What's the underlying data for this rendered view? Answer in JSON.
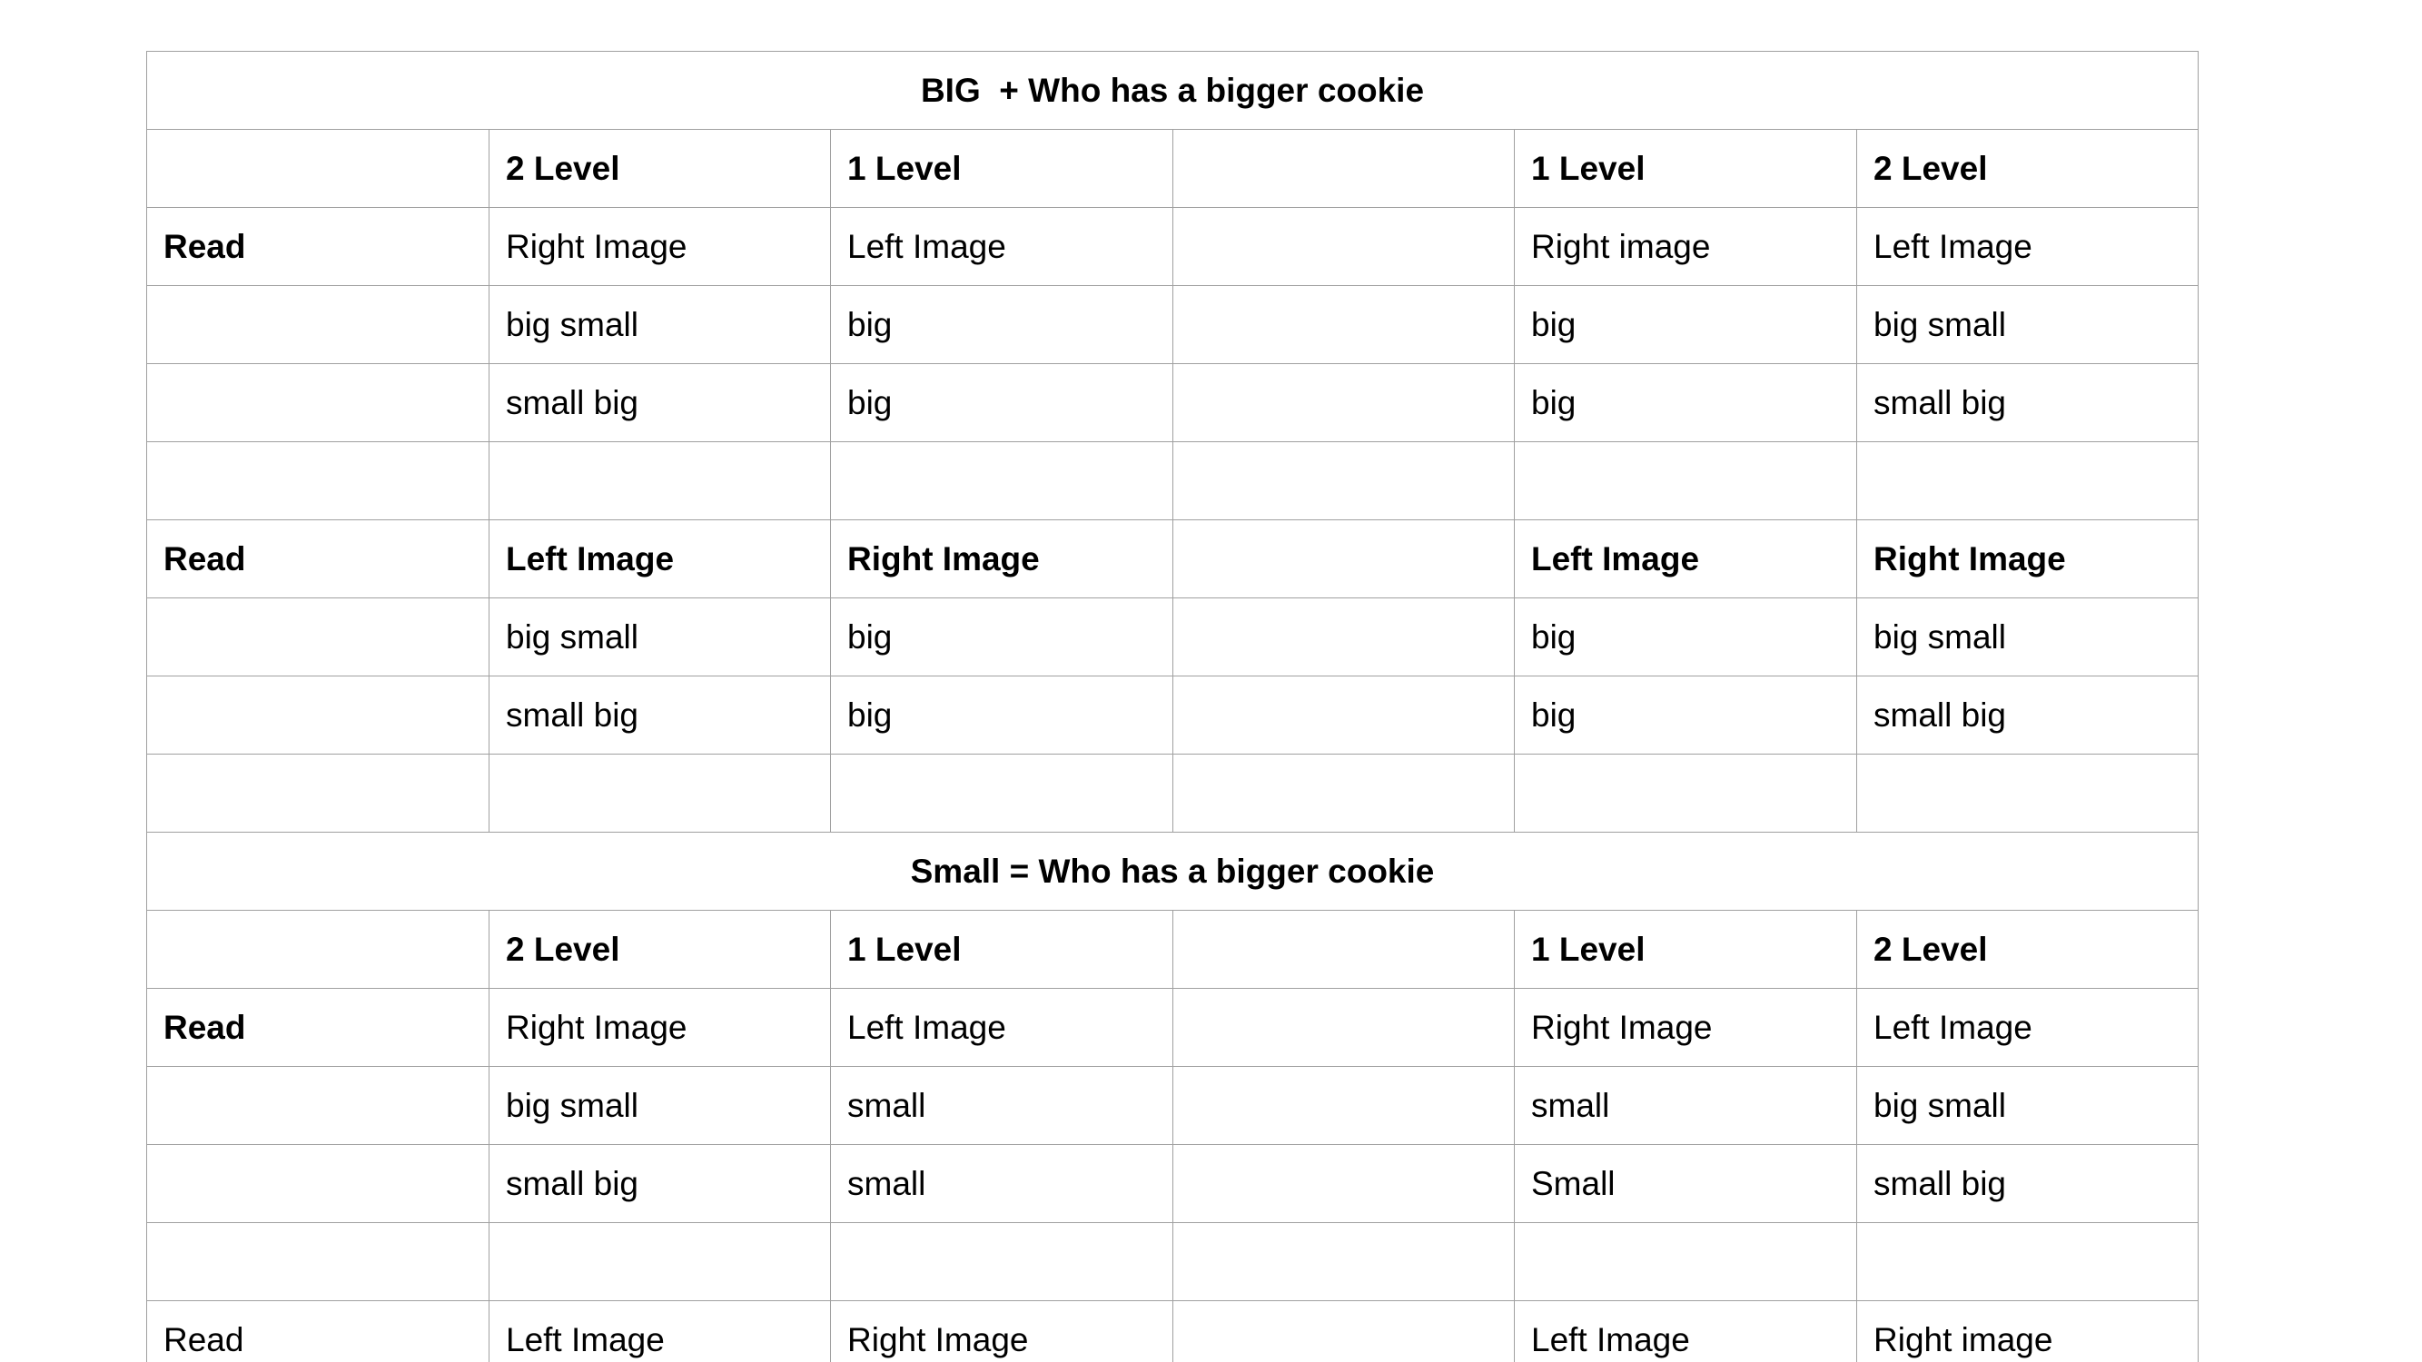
{
  "doc": {
    "rows": [
      {
        "type": "title",
        "text": "BIG  + Who has a bigger cookie"
      },
      {
        "type": "cells",
        "bold": true,
        "cells": [
          "",
          "2 Level",
          "1 Level",
          "",
          "1 Level",
          "2 Level"
        ]
      },
      {
        "type": "cells",
        "boldFirst": true,
        "cells": [
          "Read",
          "Right Image",
          "Left Image",
          "",
          "Right image",
          "Left Image"
        ]
      },
      {
        "type": "cells",
        "cells": [
          "",
          "big small",
          "big",
          "",
          "big",
          "big small"
        ]
      },
      {
        "type": "cells",
        "cells": [
          "",
          "small big",
          "big",
          "",
          "big",
          "small big"
        ]
      },
      {
        "type": "cells",
        "cells": [
          "",
          "",
          "",
          "",
          "",
          ""
        ]
      },
      {
        "type": "cells",
        "bold": true,
        "cells": [
          "Read",
          "Left Image",
          "Right Image",
          "",
          "Left Image",
          "Right Image"
        ]
      },
      {
        "type": "cells",
        "cells": [
          "",
          "big small",
          "big",
          "",
          "big",
          "big small"
        ]
      },
      {
        "type": "cells",
        "cells": [
          "",
          "small big",
          "big",
          "",
          "big",
          "small big"
        ]
      },
      {
        "type": "cells",
        "cells": [
          "",
          "",
          "",
          "",
          "",
          ""
        ]
      },
      {
        "type": "title",
        "text": "Small = Who has a bigger cookie"
      },
      {
        "type": "cells",
        "bold": true,
        "cells": [
          "",
          "2 Level",
          "1 Level",
          "",
          "1 Level",
          "2 Level"
        ]
      },
      {
        "type": "cells",
        "boldFirst": true,
        "cells": [
          "Read",
          "Right Image",
          "Left Image",
          "",
          "Right Image",
          "Left Image"
        ]
      },
      {
        "type": "cells",
        "cells": [
          "",
          "big small",
          "small",
          "",
          "small",
          "big small"
        ]
      },
      {
        "type": "cells",
        "cells": [
          "",
          "small big",
          "small",
          "",
          "Small",
          "small big"
        ]
      },
      {
        "type": "cells",
        "cells": [
          "",
          "",
          "",
          "",
          "",
          ""
        ]
      },
      {
        "type": "cells",
        "cells": [
          "Read",
          "Left Image",
          "Right Image",
          "",
          "Left Image",
          "Right image"
        ]
      }
    ]
  }
}
